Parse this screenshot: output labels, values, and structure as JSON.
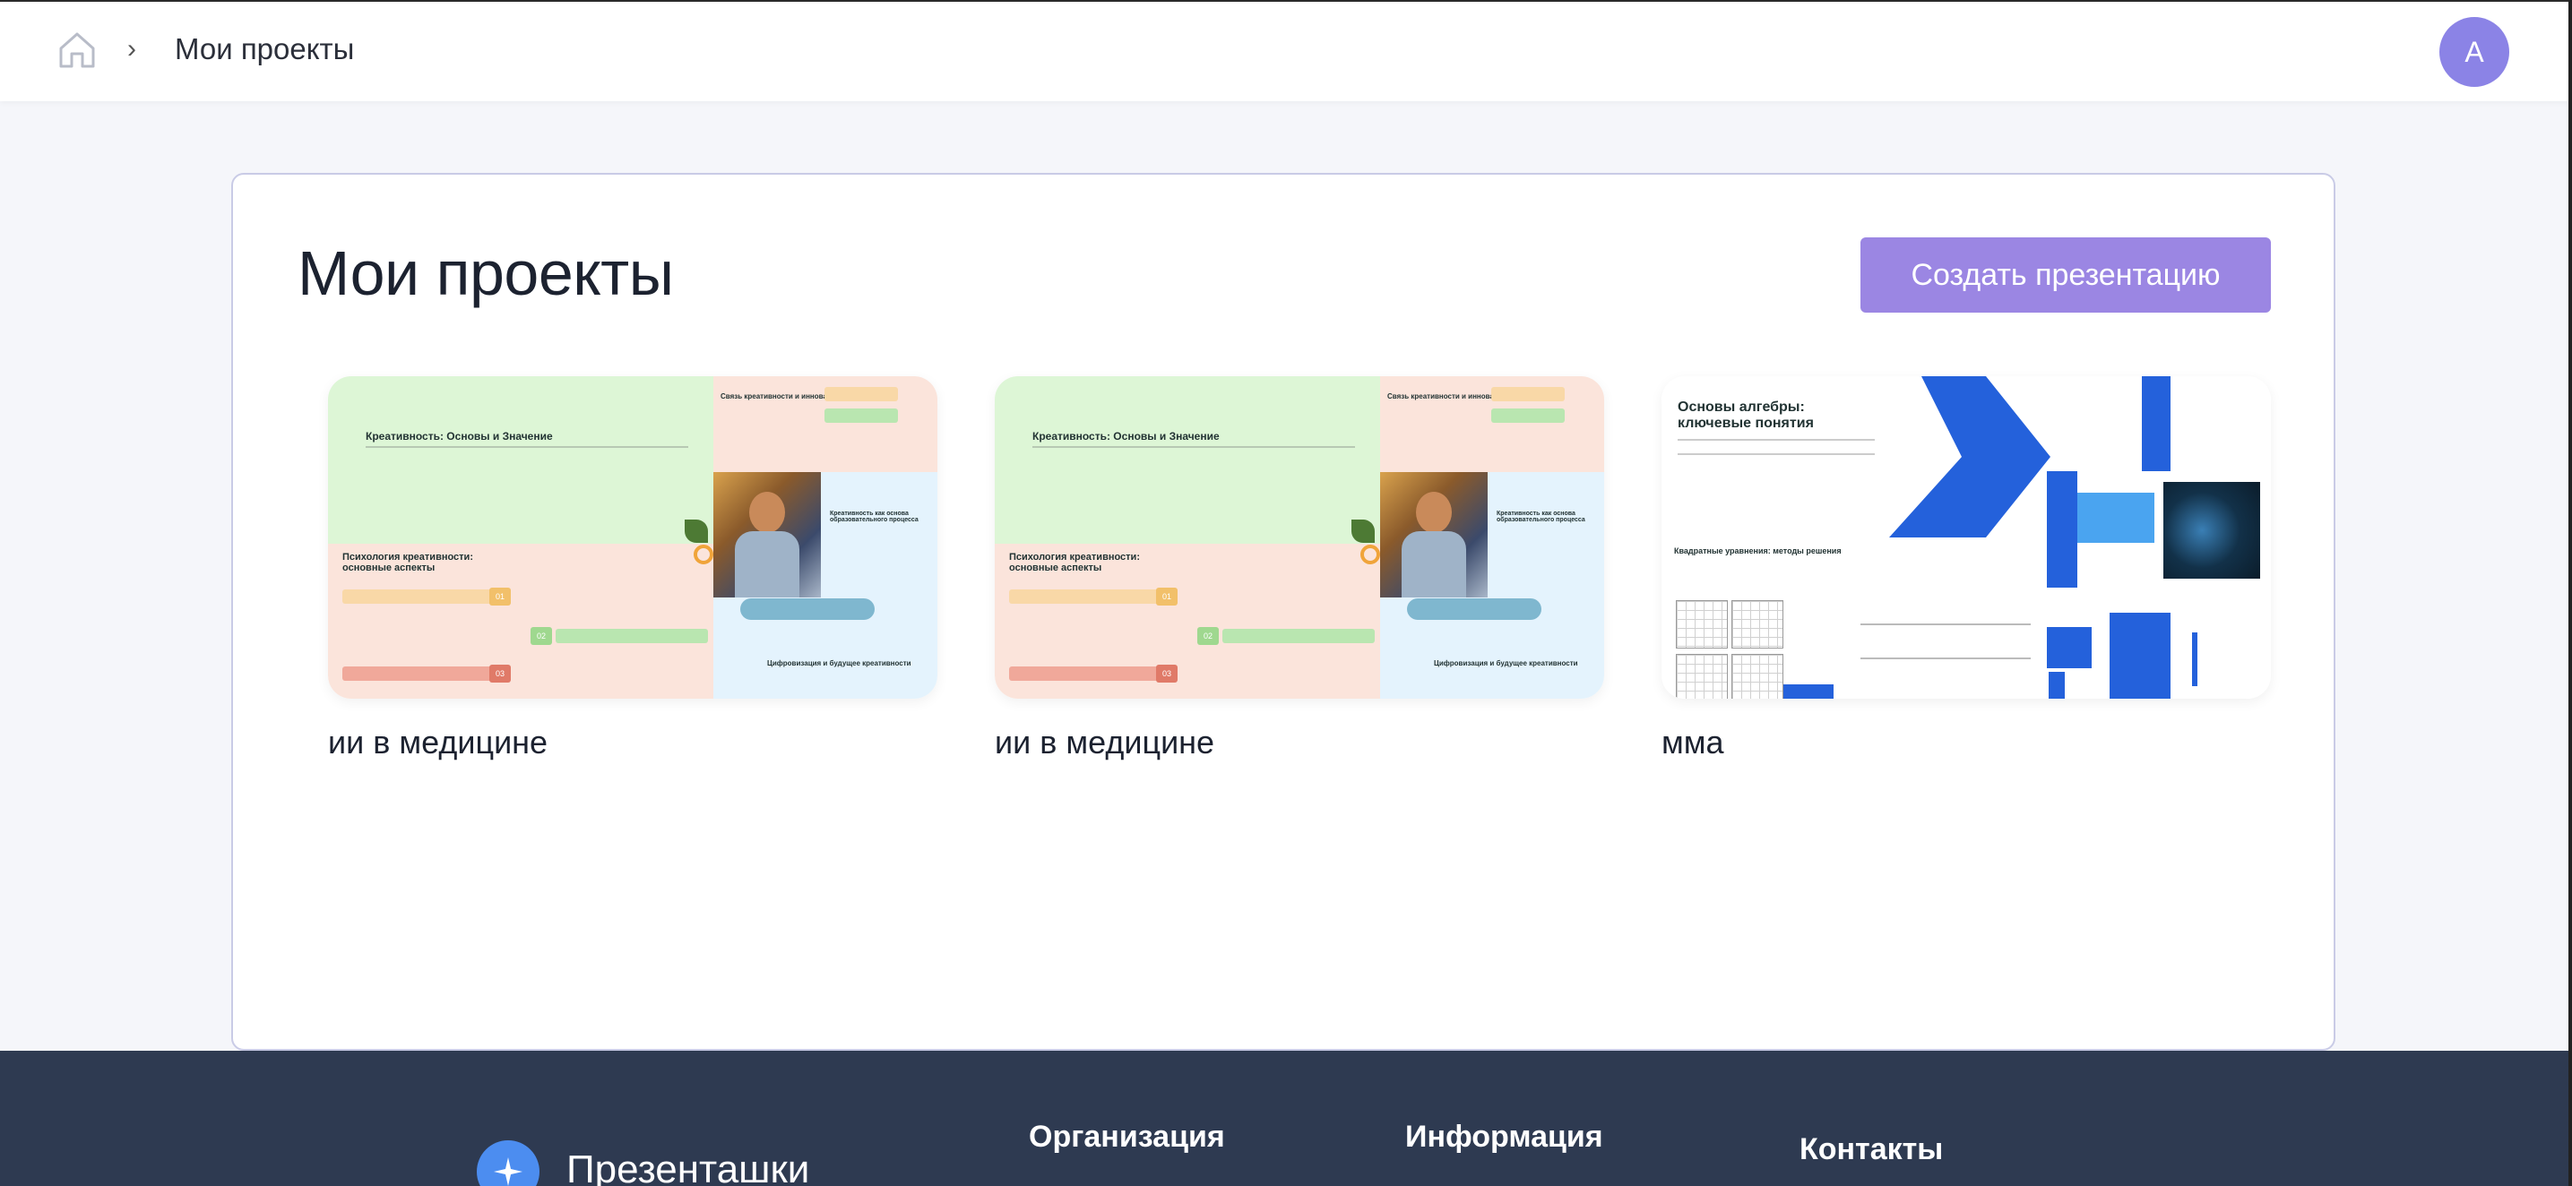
{
  "header": {
    "breadcrumb_separator": "›",
    "breadcrumb_title": "Мои проекты",
    "avatar_initial": "А"
  },
  "main": {
    "title": "Мои проекты",
    "create_button": "Создать презентацию",
    "projects": [
      {
        "name": "ии в медицине",
        "thumbnail": {
          "heading1": "Креативность: Основы и Значение",
          "heading2": "Связь креативности и инноваций",
          "heading3": "Психология креативности: основные аспекты",
          "heading4": "Креативность как основа образовательного процесса",
          "heading5": "Цифровизация и будущее креативности",
          "num1": "01",
          "num2": "02",
          "num3": "03"
        }
      },
      {
        "name": "ии в медицине",
        "thumbnail": {
          "heading1": "Креативность: Основы и Значение",
          "heading2": "Связь креативности и инноваций",
          "heading3": "Психология креативности: основные аспекты",
          "heading4": "Креативность как основа образовательного процесса",
          "heading5": "Цифровизация и будущее креативности",
          "num1": "01",
          "num2": "02",
          "num3": "03"
        }
      },
      {
        "name": "мма",
        "thumbnail": {
          "heading1": "Основы алгебры: ключевые понятия",
          "heading2": "Квадратные уравнения: методы решения"
        }
      }
    ]
  },
  "footer": {
    "logo_text": "Презенташки",
    "col1": "Организация",
    "col2": "Информация",
    "col3": "Контакты"
  },
  "colors": {
    "accent_button": "#9b86e3",
    "avatar": "#8b83e6",
    "footer_bg": "#2e3a51",
    "thumb_blue": "#2461db"
  }
}
